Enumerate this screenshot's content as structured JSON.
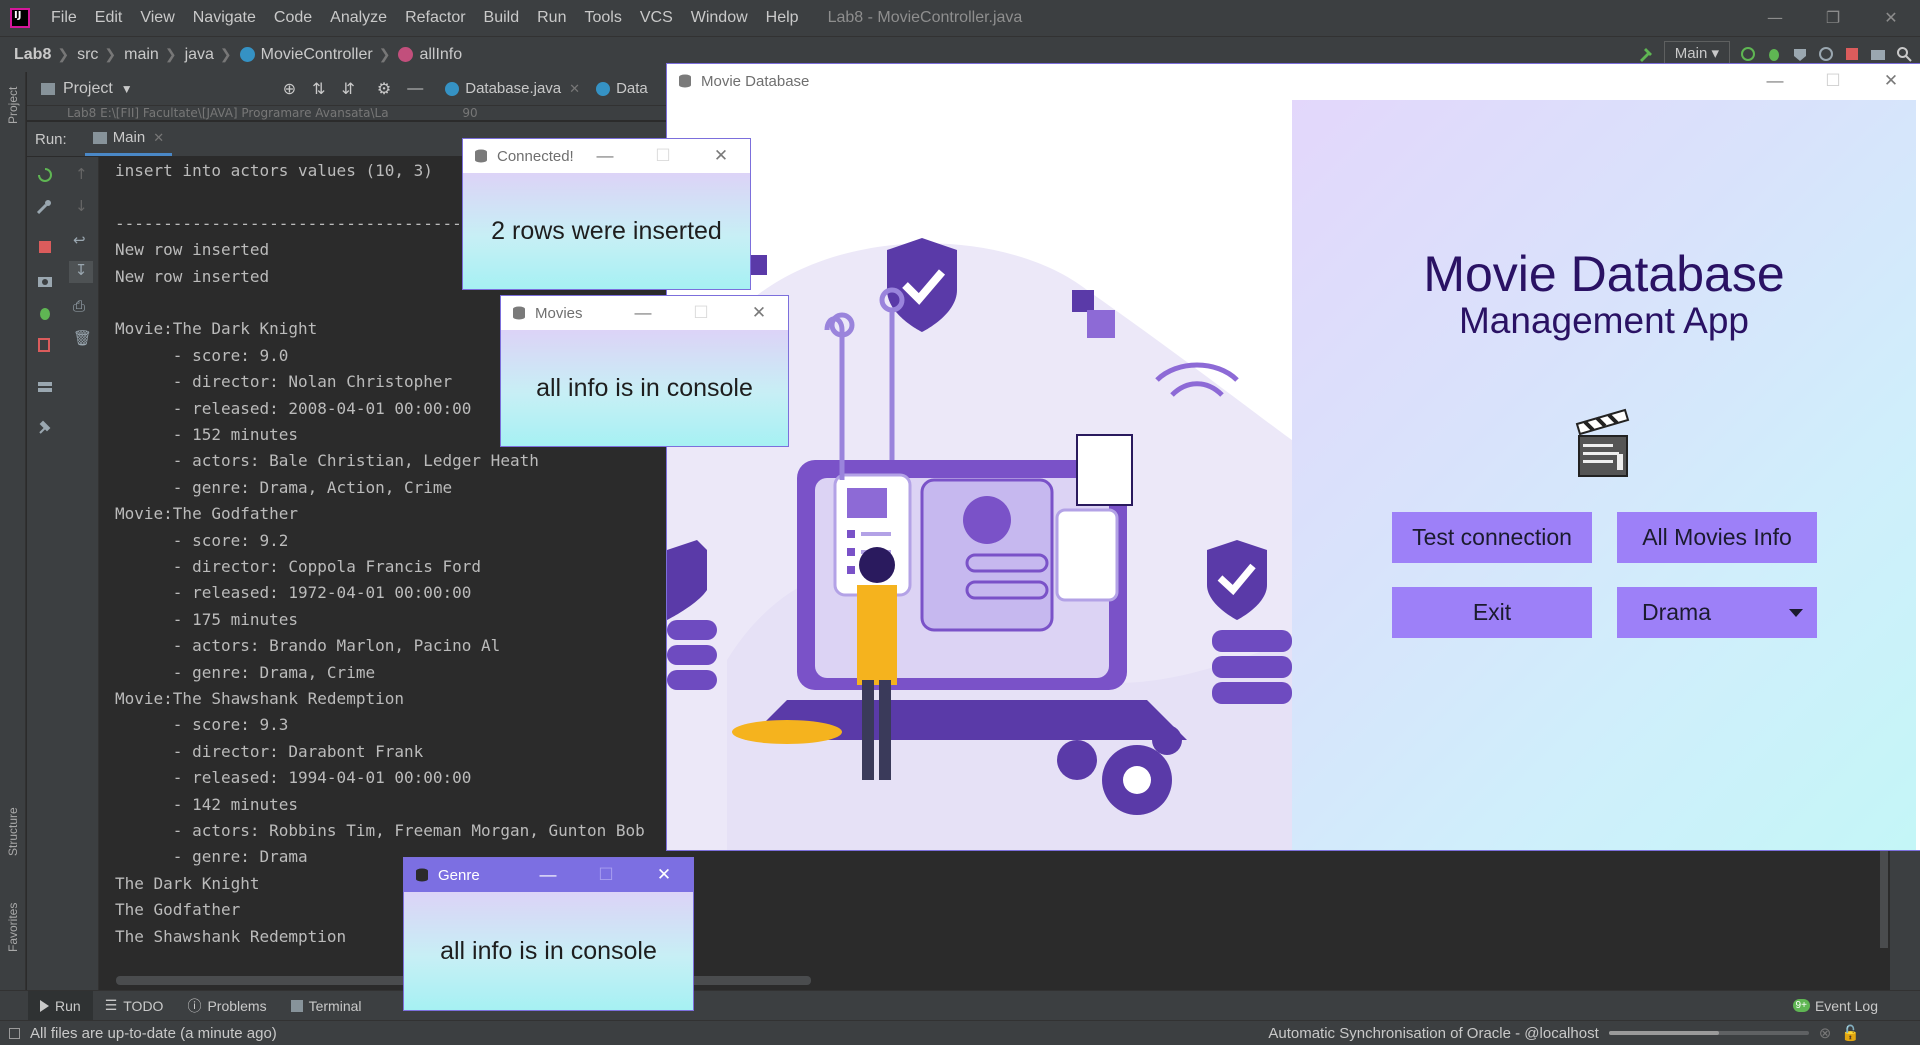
{
  "ide": {
    "menu": [
      "File",
      "Edit",
      "View",
      "Navigate",
      "Code",
      "Analyze",
      "Refactor",
      "Build",
      "Run",
      "Tools",
      "VCS",
      "Window",
      "Help"
    ],
    "window_title": "Lab8 - MovieController.java",
    "breadcrumbs": [
      "Lab8",
      "src",
      "main",
      "java",
      "MovieController",
      "allInfo"
    ],
    "run_config": "Main",
    "project_label": "Project",
    "editor_tabs": [
      "Database.java",
      "Data"
    ],
    "tree_row_text": "Lab8  E:\\[FII] Facultate\\[JAVA] Programare Avansata\\La",
    "tree_row_num": "90",
    "run_label": "Run:",
    "run_tab": "Main",
    "left_vertical_tabs": [
      "Project",
      "Structure",
      "Favorites"
    ],
    "console_lines": [
      "insert into actors values (10, 3)",
      "",
      "-------------------------------------",
      "New row inserted",
      "New row inserted",
      "",
      "Movie:The Dark Knight",
      "      - score: 9.0",
      "      - director: Nolan Christopher",
      "      - released: 2008-04-01 00:00:00",
      "      - 152 minutes",
      "      - actors: Bale Christian, Ledger Heath",
      "      - genre: Drama, Action, Crime",
      "Movie:The Godfather",
      "      - score: 9.2",
      "      - director: Coppola Francis Ford",
      "      - released: 1972-04-01 00:00:00",
      "      - 175 minutes",
      "      - actors: Brando Marlon, Pacino Al",
      "      - genre: Drama, Crime",
      "Movie:The Shawshank Redemption",
      "      - score: 9.3",
      "      - director: Darabont Frank",
      "      - released: 1994-04-01 00:00:00",
      "      - 142 minutes",
      "      - actors: Robbins Tim, Freeman Morgan, Gunton Bob",
      "      - genre: Drama",
      "The Dark Knight",
      "The Godfather",
      "The Shawshank Redemption"
    ],
    "bottom_tabs": [
      "Run",
      "TODO",
      "Problems",
      "Terminal"
    ],
    "event_log": "Event Log",
    "event_badge": "9+",
    "status_left": "All files are up-to-date (a minute ago)",
    "status_right": "Automatic Synchronisation of Oracle - @localhost",
    "sync_progress": 0.55
  },
  "main_window": {
    "title": "Movie Database",
    "app_title_line1": "Movie Database",
    "app_title_line2": "Management App",
    "buttons": {
      "test_connection": "Test connection",
      "all_movies_info": "All Movies Info",
      "exit": "Exit",
      "genre_selected": "Drama"
    }
  },
  "dialogs": {
    "connected": {
      "title": "Connected!",
      "message": "2 rows were inserted"
    },
    "movies": {
      "title": "Movies",
      "message": "all info is in console"
    },
    "genre": {
      "title": "Genre",
      "message": "all info is in console"
    }
  },
  "colors": {
    "ide_bg": "#2b2b2b",
    "ide_panel": "#3c3f41",
    "fx_button": "#9d80f8",
    "title_text": "#2a1264",
    "genre_titlebar": "#7c6fe2"
  }
}
